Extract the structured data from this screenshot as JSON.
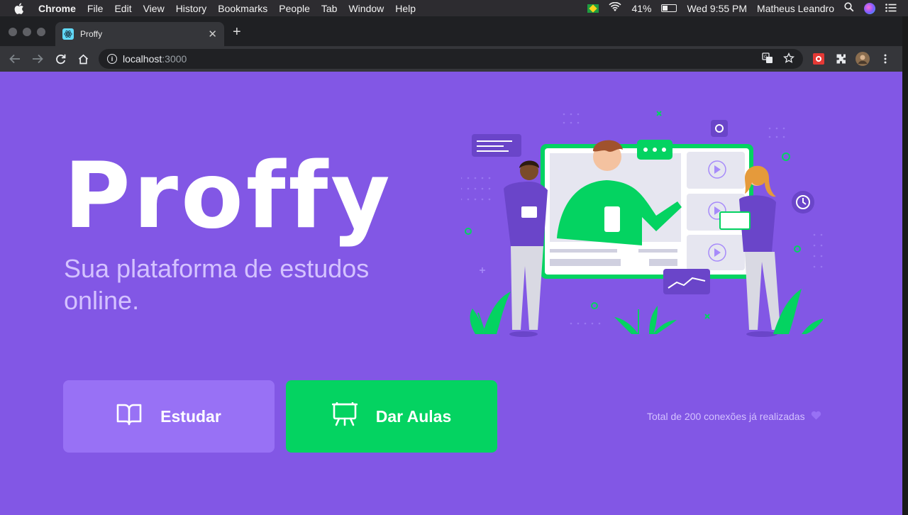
{
  "menubar": {
    "app_name": "Chrome",
    "items": [
      "File",
      "Edit",
      "View",
      "History",
      "Bookmarks",
      "People",
      "Tab",
      "Window",
      "Help"
    ],
    "battery": "41%",
    "battery_level": 0.41,
    "datetime": "Wed 9:55 PM",
    "user": "Matheus Leandro"
  },
  "browser": {
    "tab_title": "Proffy",
    "url_host": "localhost",
    "url_port": ":3000"
  },
  "page": {
    "logo": "Proffy",
    "tagline": "Sua plataforma de estudos online.",
    "study_button": "Estudar",
    "teach_button": "Dar Aulas",
    "total_connections": "Total de 200 conexões já realizadas"
  },
  "colors": {
    "primary": "#8257e5",
    "primary_light": "#9871f5",
    "secondary": "#04d361",
    "text_in_primary": "#d4c2ff"
  }
}
